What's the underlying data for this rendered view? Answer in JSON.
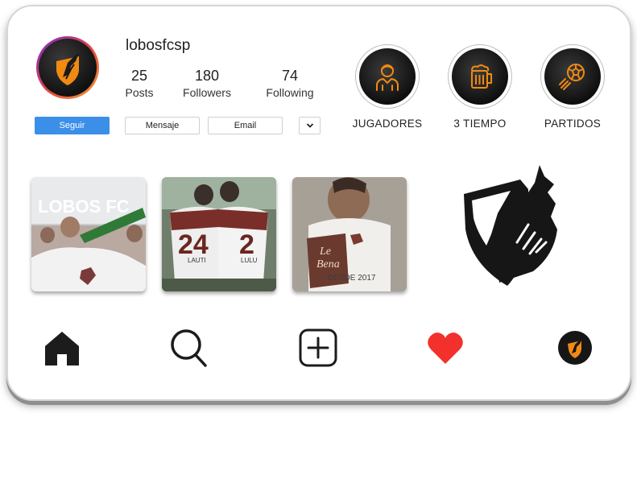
{
  "profile": {
    "username": "lobosfcsp",
    "stats": [
      {
        "value": "25",
        "label": "Posts"
      },
      {
        "value": "180",
        "label": "Followers"
      },
      {
        "value": "74",
        "label": "Following"
      }
    ]
  },
  "actions": {
    "follow": "Seguir",
    "message": "Mensaje",
    "email": "Email"
  },
  "highlights": [
    {
      "label": "JUGADORES",
      "icon": "player-icon"
    },
    {
      "label": "3 TIEMPO",
      "icon": "beer-mug-icon"
    },
    {
      "label": "PARTIDOS",
      "icon": "soccer-ball-icon"
    }
  ],
  "posts": [
    {
      "caption": "LOBOS FC"
    },
    {
      "jersey_left": "24",
      "jersey_right": "2",
      "name_left": "LAUTI",
      "name_right": "LULU"
    },
    {
      "caption": "DESDE 2017"
    }
  ],
  "bottom_nav": [
    "home-icon",
    "search-icon",
    "add-post-icon",
    "heart-icon",
    "profile-avatar-icon"
  ],
  "colors": {
    "accent": "#f08a12",
    "primary_button": "#3b8fe8",
    "heart": "#f2312c"
  }
}
